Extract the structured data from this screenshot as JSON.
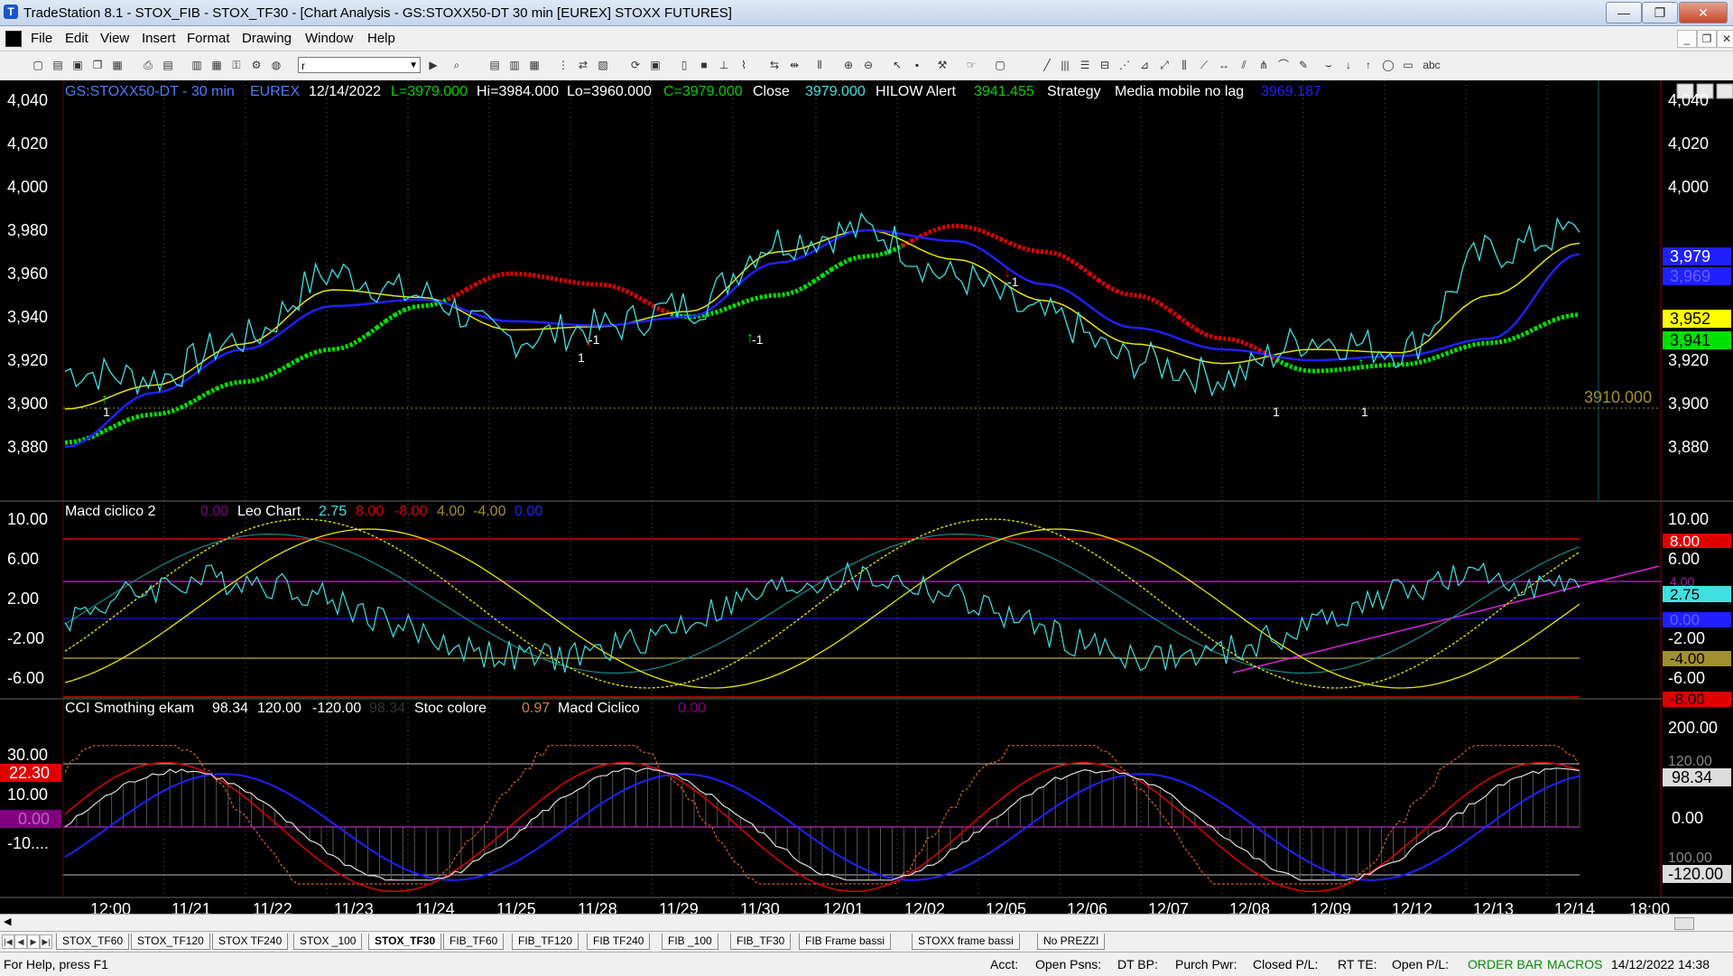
{
  "window": {
    "title": "TradeStation 8.1 - STOX_FIB - STOX_TF30 - [Chart Analysis - GS:STOXX50-DT  30 min  [EUREX] STOXX FUTURES]",
    "minimize": "—",
    "maximize": "❐",
    "close": "✕"
  },
  "menu": [
    "File",
    "Edit",
    "View",
    "Insert",
    "Format",
    "Drawing",
    "Window",
    "Help"
  ],
  "toolbar": {
    "symbol_value": "r"
  },
  "chart": {
    "header": {
      "symbol": "GS:STOXX50-DT - 30 min",
      "exchange": "EUREX",
      "date": "12/14/2022",
      "last": "L=3979.000",
      "high": "Hi=3984.000",
      "low": "Lo=3960.000",
      "close_val": "C=3979.000",
      "close_label": "Close",
      "close_value": "3979.000",
      "hilow_label": "HILOW Alert",
      "hilow_value": "3941.455",
      "strategy_label": "Strategy",
      "ma_label": "Media mobile no lag",
      "ma_value": "3969.187"
    },
    "price_axis": [
      "4,040",
      "4,020",
      "4,000",
      "3,980",
      "3,960",
      "3,940",
      "3,920",
      "3,900",
      "3,880"
    ],
    "price_tags": {
      "last": "3,979",
      "ma": "3,969",
      "hilow": "3,952",
      "green": "3,941"
    },
    "hline_label": "3910.000",
    "markers": [
      "1",
      "-1",
      "-1",
      "1",
      "1",
      "-1",
      "1"
    ],
    "macd_panel": {
      "name": "Macd ciclico 2",
      "v1": "0.00",
      "leo_label": "Leo Chart",
      "v2": "2.75",
      "v3": "8.00",
      "v4": "-8.00",
      "v5": "4.00",
      "v6": "-4.00",
      "v7": "0.00",
      "axis_left": [
        "10.00",
        "6.00",
        "2.00",
        "-2.00",
        "-6.00"
      ],
      "axis_right": [
        "10.00",
        "6.00",
        "2.00",
        "-2.00",
        "-6.00"
      ],
      "tags": {
        "t8": "8.00",
        "t4": "4.00",
        "t275": "2.75",
        "t0": "0.00",
        "tm4": "-4.00",
        "tm8": "-8.00"
      }
    },
    "cci_panel": {
      "name": "CCI Smothing ekam",
      "v1": "98.34",
      "v2": "120.00",
      "v3": "-120.00",
      "v4": "98.34",
      "stoc_label": "Stoc colore",
      "stoc_value": "0.97",
      "macd_label": "Macd Ciclico",
      "macd_value": "0.00",
      "axis_left": [
        "30.00",
        "10.00",
        "-10...."
      ],
      "left_tags": {
        "t1": "22.30",
        "t2": "0.00"
      },
      "axis_right": [
        "200.00",
        "0.00",
        "120.00",
        "100.00"
      ],
      "right_tags": {
        "t1": "98.34",
        "t2": "-120.00"
      }
    },
    "time_axis": [
      "12:00",
      "11/21",
      "11/22",
      "11/23",
      "11/24",
      "11/25",
      "11/28",
      "11/29",
      "11/30",
      "12/01",
      "12/02",
      "12/05",
      "12/06",
      "12/07",
      "12/08",
      "12/09",
      "12/12",
      "12/13",
      "12/14",
      "18:00"
    ],
    "colors": {
      "up": "#00c000",
      "dn": "#e00000",
      "price": "#40e0e0",
      "ma_blue": "#2020ff",
      "ma_yellow": "#e6e600"
    }
  },
  "chart_data": {
    "type": "line",
    "x": [
      "11/21",
      "11/22",
      "11/23",
      "11/24",
      "11/25",
      "11/28",
      "11/29",
      "11/30",
      "12/01",
      "12/02",
      "12/05",
      "12/06",
      "12/07",
      "12/08",
      "12/09",
      "12/12",
      "12/13",
      "12/14"
    ],
    "series": [
      {
        "name": "Close",
        "values": [
          3915,
          3912,
          3930,
          3960,
          3950,
          3930,
          3935,
          3945,
          3975,
          3980,
          3958,
          3940,
          3920,
          3912,
          3930,
          3925,
          3970,
          3979
        ]
      },
      {
        "name": "Media mobile no lag",
        "values": [
          3880,
          3905,
          3925,
          3945,
          3948,
          3938,
          3936,
          3940,
          3965,
          3980,
          3975,
          3955,
          3935,
          3925,
          3920,
          3922,
          3930,
          3969
        ]
      },
      {
        "name": "HILOW Alert",
        "values": [
          3882,
          3895,
          3910,
          3925,
          3945,
          3960,
          3955,
          3940,
          3950,
          3968,
          3982,
          3970,
          3950,
          3930,
          3915,
          3918,
          3928,
          3941
        ]
      }
    ],
    "ylim": [
      3870,
      4050
    ]
  },
  "tabs": [
    "STOX_TF60",
    "STOX_TF120",
    "STOX TF240",
    "STOX _100",
    "STOX_TF30",
    "FIB_TF60",
    "FIB_TF120",
    "FIB TF240",
    "FIB _100",
    "FIB_TF30",
    "FIB Frame bassi",
    "STOXX frame bassi",
    "No PREZZI"
  ],
  "active_tab": 4,
  "status": {
    "help": "For Help, press F1",
    "acct": "Acct:",
    "open_psns": "Open Psns:",
    "dt_bp": "DT BP:",
    "purch_pwr": "Purch Pwr:",
    "closed_pl": "Closed P/L:",
    "rt_te": "RT TE:",
    "open_pl": "Open P/L:",
    "order_bar": "ORDER BAR",
    "macros": "MACROS",
    "datetime": "14/12/2022 14:38"
  }
}
